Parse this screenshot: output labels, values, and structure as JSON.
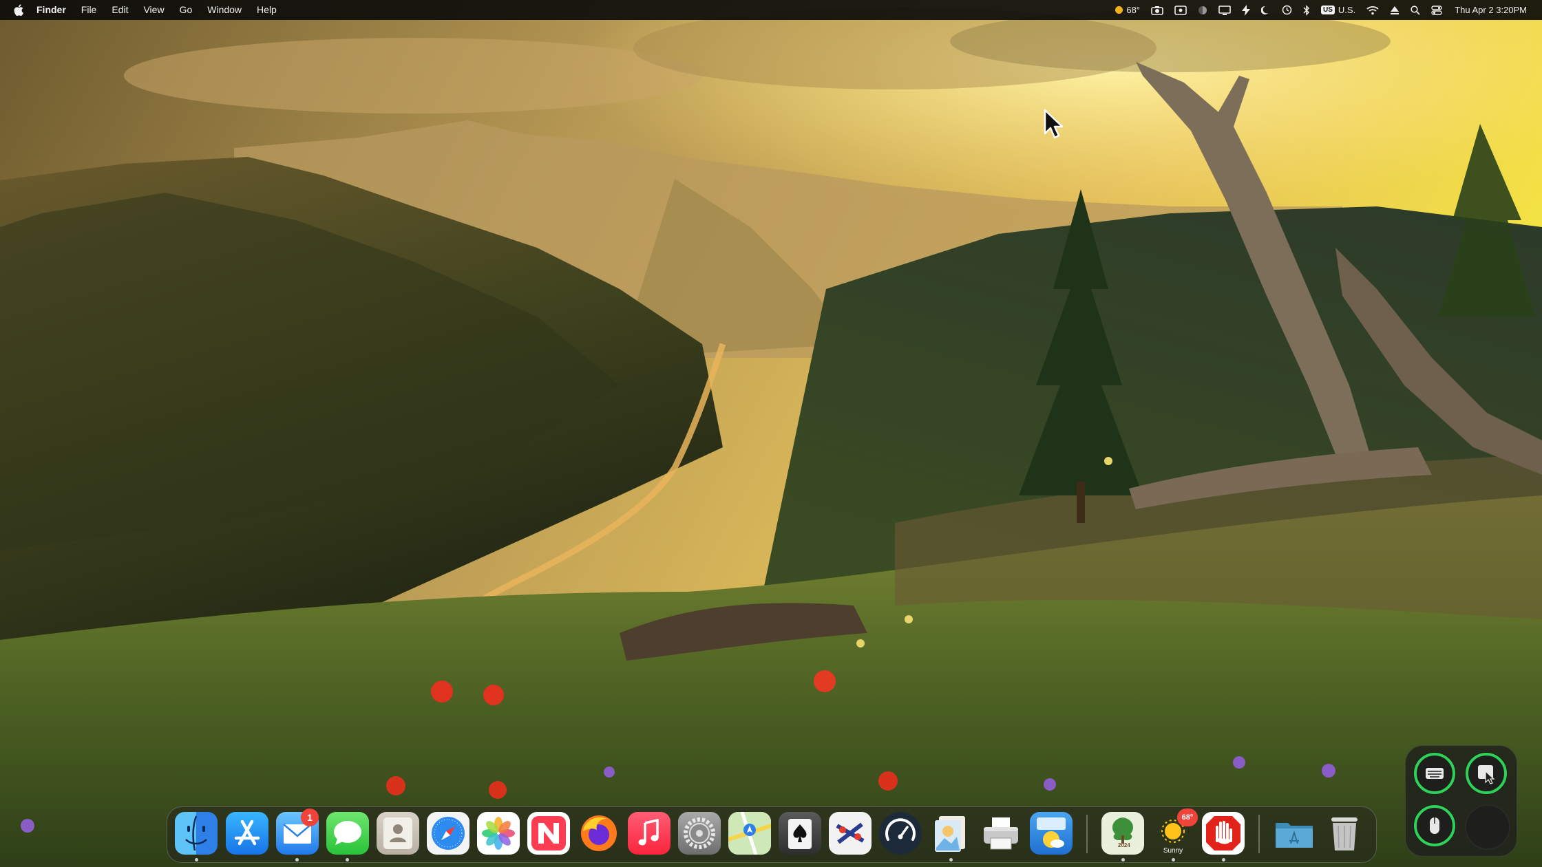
{
  "menubar": {
    "apple_icon": "apple-logo-icon",
    "app_name": "Finder",
    "menus": [
      "File",
      "Edit",
      "View",
      "Go",
      "Window",
      "Help"
    ],
    "status": {
      "weather_temp": "68°",
      "input_source": "U.S.",
      "input_badge": "US",
      "clock": "Thu Apr 2  3:20PM"
    }
  },
  "dock": {
    "apps": [
      {
        "name": "Finder",
        "icon": "finder-icon",
        "running": true
      },
      {
        "name": "App Store",
        "icon": "app-store-icon",
        "running": false
      },
      {
        "name": "Mail",
        "icon": "mail-icon",
        "running": true,
        "badge": "1"
      },
      {
        "name": "Messages",
        "icon": "messages-icon",
        "running": true
      },
      {
        "name": "Contacts",
        "icon": "contacts-icon",
        "running": false
      },
      {
        "name": "Safari",
        "icon": "safari-icon",
        "running": false
      },
      {
        "name": "Photos",
        "icon": "photos-icon",
        "running": false
      },
      {
        "name": "News",
        "icon": "news-icon",
        "running": false
      },
      {
        "name": "Firefox",
        "icon": "firefox-icon",
        "running": false
      },
      {
        "name": "Music",
        "icon": "music-icon",
        "running": false
      },
      {
        "name": "System Settings",
        "icon": "system-settings-icon",
        "running": false
      },
      {
        "name": "Maps",
        "icon": "maps-icon",
        "running": false
      },
      {
        "name": "Solitaire",
        "icon": "solitaire-icon",
        "running": false
      },
      {
        "name": "Network Radar",
        "icon": "network-radar-icon",
        "running": false
      },
      {
        "name": "Speed Test",
        "icon": "speedometer-icon",
        "running": false
      },
      {
        "name": "Preview",
        "icon": "preview-icon",
        "running": true
      },
      {
        "name": "Printer",
        "icon": "printer-icon",
        "running": false
      },
      {
        "name": "Weather Widget",
        "icon": "weather-clock-icon",
        "running": false
      }
    ],
    "pinned": [
      {
        "name": "Calendar 2024",
        "icon": "tree-calendar-icon",
        "label": "2024",
        "running": true
      },
      {
        "name": "Sunny Weather",
        "icon": "sun-icon",
        "badge": "68°",
        "label": "Sunny",
        "running": true
      },
      {
        "name": "Block App",
        "icon": "stop-hand-icon",
        "running": true
      }
    ],
    "right": [
      {
        "name": "Applications Folder",
        "icon": "folder-icon"
      },
      {
        "name": "Trash",
        "icon": "trash-icon"
      }
    ]
  },
  "widget": {
    "buttons": [
      "keyboard-icon",
      "pointer-window-icon",
      "mouse-icon",
      "empty-slot"
    ],
    "accent": "#2fd158"
  },
  "colors": {
    "badge": "#f0433a",
    "accent_green": "#2fd158"
  }
}
